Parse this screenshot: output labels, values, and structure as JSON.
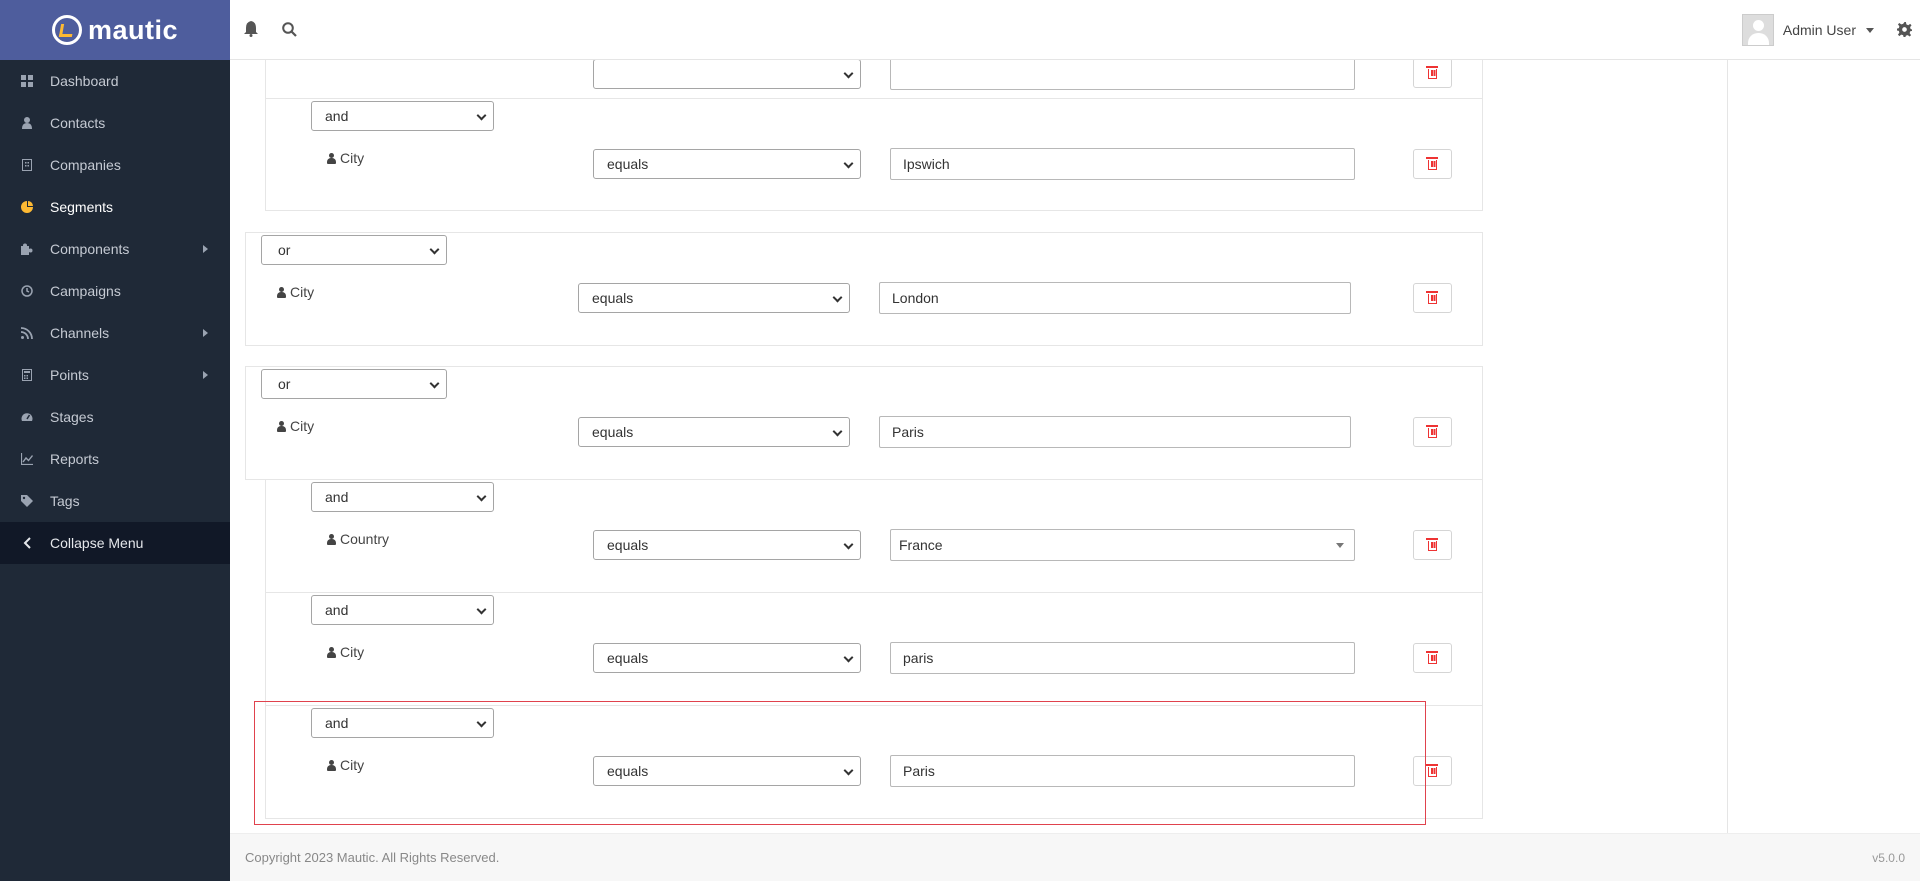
{
  "brand": {
    "name": "mautic"
  },
  "sidebar": {
    "items": [
      {
        "label": "Dashboard",
        "icon": "dashboard-icon"
      },
      {
        "label": "Contacts",
        "icon": "user-icon"
      },
      {
        "label": "Companies",
        "icon": "building-icon"
      },
      {
        "label": "Segments",
        "icon": "pie-chart-icon",
        "active": true
      },
      {
        "label": "Components",
        "icon": "puzzle-icon",
        "submenu": true
      },
      {
        "label": "Campaigns",
        "icon": "clock-icon"
      },
      {
        "label": "Channels",
        "icon": "rss-icon",
        "submenu": true
      },
      {
        "label": "Points",
        "icon": "calculator-icon",
        "submenu": true
      },
      {
        "label": "Stages",
        "icon": "tachometer-icon"
      },
      {
        "label": "Reports",
        "icon": "line-chart-icon"
      },
      {
        "label": "Tags",
        "icon": "tag-icon"
      }
    ],
    "collapse_label": "Collapse Menu"
  },
  "topbar": {
    "user_name": "Admin User"
  },
  "filters": [
    {
      "glue": "and",
      "field": "City",
      "operator": "equals",
      "value": "Ipswich"
    },
    {
      "glue": "or",
      "field": "City",
      "operator": "equals",
      "value": "London"
    },
    {
      "glue": "or",
      "field": "City",
      "operator": "equals",
      "value": "Paris"
    },
    {
      "glue": "and",
      "field": "Country",
      "operator": "equals",
      "value": "France"
    },
    {
      "glue": "and",
      "field": "City",
      "operator": "equals",
      "value": "paris"
    },
    {
      "glue": "and",
      "field": "City",
      "operator": "equals",
      "value": "Paris"
    }
  ],
  "footer": {
    "copyright": "Copyright 2023 Mautic. All Rights Reserved.",
    "version": "v5.0.0"
  },
  "colors": {
    "brand_bar": "#4e5d9d",
    "sidebar_bg": "#1f2937",
    "accent": "#fdb933",
    "delete_red": "#e33",
    "highlight_border": "#e0424d"
  }
}
